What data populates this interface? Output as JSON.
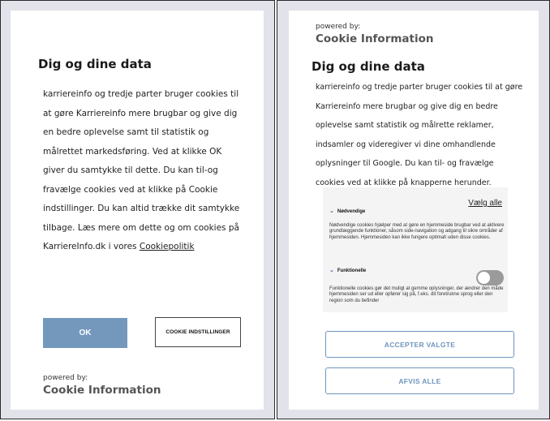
{
  "left": {
    "title": "Dig og dine data",
    "body": "karriereinfo og tredje parter bruger cookies til at gøre Karriereinfo mere brugbar og give dig en bedre oplevelse samt til statistik og målrettet markedsføring. Ved at klikke OK giver du samtykke til dette. Du kan til-og fravælge cookies ved at klikke på Cookie indstillinger. Du kan altid trække dit samtykke tilbage. Læs mere om dette og om cookies på KarriereInfo.dk i vores ",
    "link": "Cookiepolitik",
    "ok_label": "OK",
    "settings_label": "COOKIE INDSTILLINGER",
    "powered_by": "powered by:",
    "brand": "Cookie Information"
  },
  "right": {
    "powered_by": "powered by:",
    "brand": "Cookie Information",
    "title": "Dig og dine data",
    "body": "karriereinfo og tredje parter bruger cookies til at gøre Karriereinfo mere brugbar og give dig en bedre oplevelse samt statistik og målrette reklamer, indsamler og videregiver vi dine omhandlende oplysninger til Google. Du kan til- og fravælge cookies ved at klikke på knapperne herunder.",
    "select_all": "Vælg alle",
    "categories": [
      {
        "name": "Nødvendige",
        "description": "Nødvendige cookies hjælper med at gøre en hjemmeside brugbar ved at aktivere grundlæggende funktioner, såsom side-navigation og adgang til sikre områder af hjemmesiden. Hjemmesiden kan ikke fungere optimalt uden disse cookies."
      },
      {
        "name": "Funktionelle",
        "description": "Funktionelle cookies gør det muligt at gemme oplysninger, der ændrer den måde hjemmesiden ser ud eller opfører sig på, f.eks. dit foretrukne sprog eller den region som du befinder",
        "toggle_on": false
      }
    ],
    "accept_label": "ACCEPTER VALGTE",
    "reject_label": "AFVIS ALLE",
    "colors": {
      "accent": "#6f95bd",
      "ok_fill": "#7398bc",
      "chevron": "#2b4a8a"
    }
  }
}
